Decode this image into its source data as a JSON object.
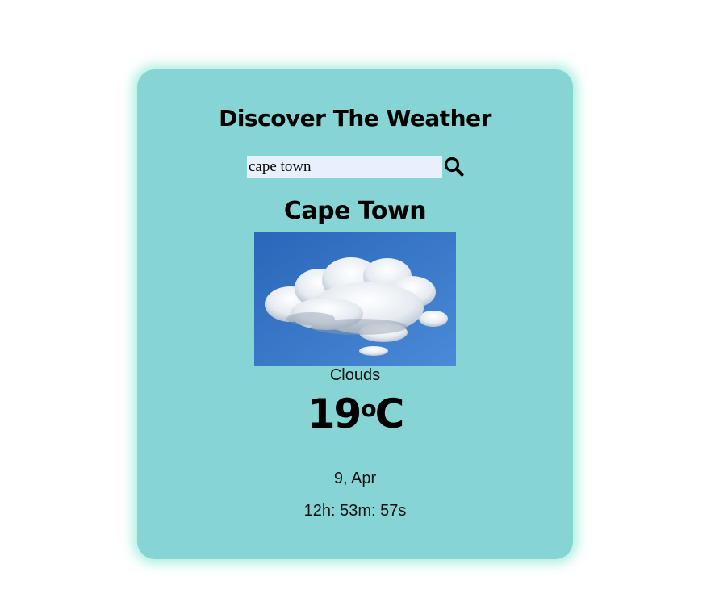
{
  "app": {
    "title": "Discover The Weather"
  },
  "search": {
    "value": "cape town",
    "icon": "search-icon"
  },
  "weather": {
    "city": "Cape Town",
    "image": "cloud-sky-image",
    "condition": "Clouds",
    "temperature": "19",
    "unit": "o",
    "unit_suffix": "C",
    "date": "9, Apr",
    "time": "12h: 53m: 57s"
  },
  "colors": {
    "card_background": "#87d4d4",
    "card_glow": "#6ee1c8",
    "input_background": "#e8f0fe",
    "sky": "#3373c6"
  }
}
